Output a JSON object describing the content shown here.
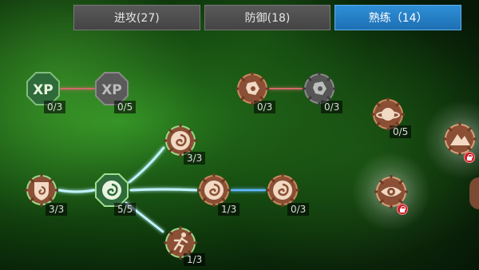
{
  "tabs": [
    {
      "label": "进攻(27)",
      "active": false
    },
    {
      "label": "防御(18)",
      "active": false
    },
    {
      "label": "熟练（14）",
      "active": true
    }
  ],
  "colors": {
    "tab_active": "#1e6fb3",
    "node_bronze": "#8a4f34",
    "node_green": "#2f6b3a",
    "node_gray": "#5a5a5a",
    "link_blue": "#8fe3ff",
    "link_red": "#d06a6a",
    "lock_red": "#c7222a"
  },
  "nodes": [
    {
      "id": "xp-1",
      "icon": "xp-icon",
      "count": "0/3",
      "state": "green"
    },
    {
      "id": "xp-2",
      "icon": "xp-icon",
      "count": "0/5",
      "state": "gray"
    },
    {
      "id": "potion",
      "icon": "potion-icon",
      "count": "0/3",
      "state": "bronze"
    },
    {
      "id": "potion-2",
      "icon": "potion-icon",
      "count": "0/3",
      "state": "gray"
    },
    {
      "id": "planet",
      "icon": "planet-icon",
      "count": "0/5",
      "state": "bronze"
    },
    {
      "id": "mountain",
      "icon": "mountain-icon",
      "count": "",
      "state": "locked"
    },
    {
      "id": "shield",
      "icon": "shield-swirl-icon",
      "count": "3/3",
      "state": "green"
    },
    {
      "id": "swirl-top",
      "icon": "swirl-icon",
      "count": "3/3",
      "state": "green"
    },
    {
      "id": "swirl-hub",
      "icon": "swirl-icon",
      "count": "5/5",
      "state": "green"
    },
    {
      "id": "swirl-mid",
      "icon": "swirl-icon",
      "count": "1/3",
      "state": "bronze"
    },
    {
      "id": "swirl-right",
      "icon": "swirl-icon",
      "count": "0/3",
      "state": "bronze"
    },
    {
      "id": "runner",
      "icon": "runner-icon",
      "count": "1/3",
      "state": "bronze"
    },
    {
      "id": "eye",
      "icon": "eye-icon",
      "count": "",
      "state": "locked"
    }
  ]
}
